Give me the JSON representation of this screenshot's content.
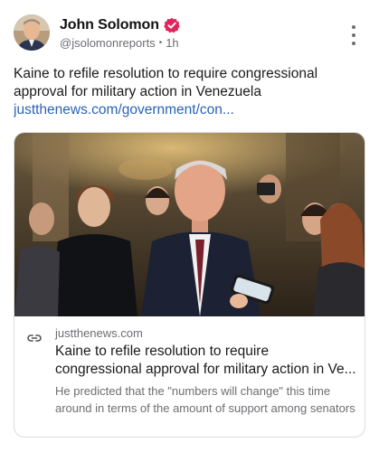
{
  "post": {
    "author": {
      "display_name": "John Solomon",
      "handle": "@jsolomonreports",
      "separator": "•",
      "time_ago": "1h",
      "verified": true,
      "avatar_icon": "author-avatar"
    },
    "more_icon": "more-vertical-icon",
    "text": "Kaine to refile resolution to require congressional approval for military action in Venezuela",
    "link_text": "justthenews.com/government/con..."
  },
  "link_card": {
    "domain": "justthenews.com",
    "link_icon": "link-icon",
    "title_line1": "Kaine to refile resolution to require",
    "title_line2": "congressional approval for military action in Ve...",
    "description": "He predicted that the \"numbers will change\" this time around in terms of the amount of support among senators"
  },
  "colors": {
    "verified_badge": "#e0245e",
    "link": "#2a63b5",
    "muted_text": "#6e6e73",
    "card_border": "#dcdce0"
  }
}
